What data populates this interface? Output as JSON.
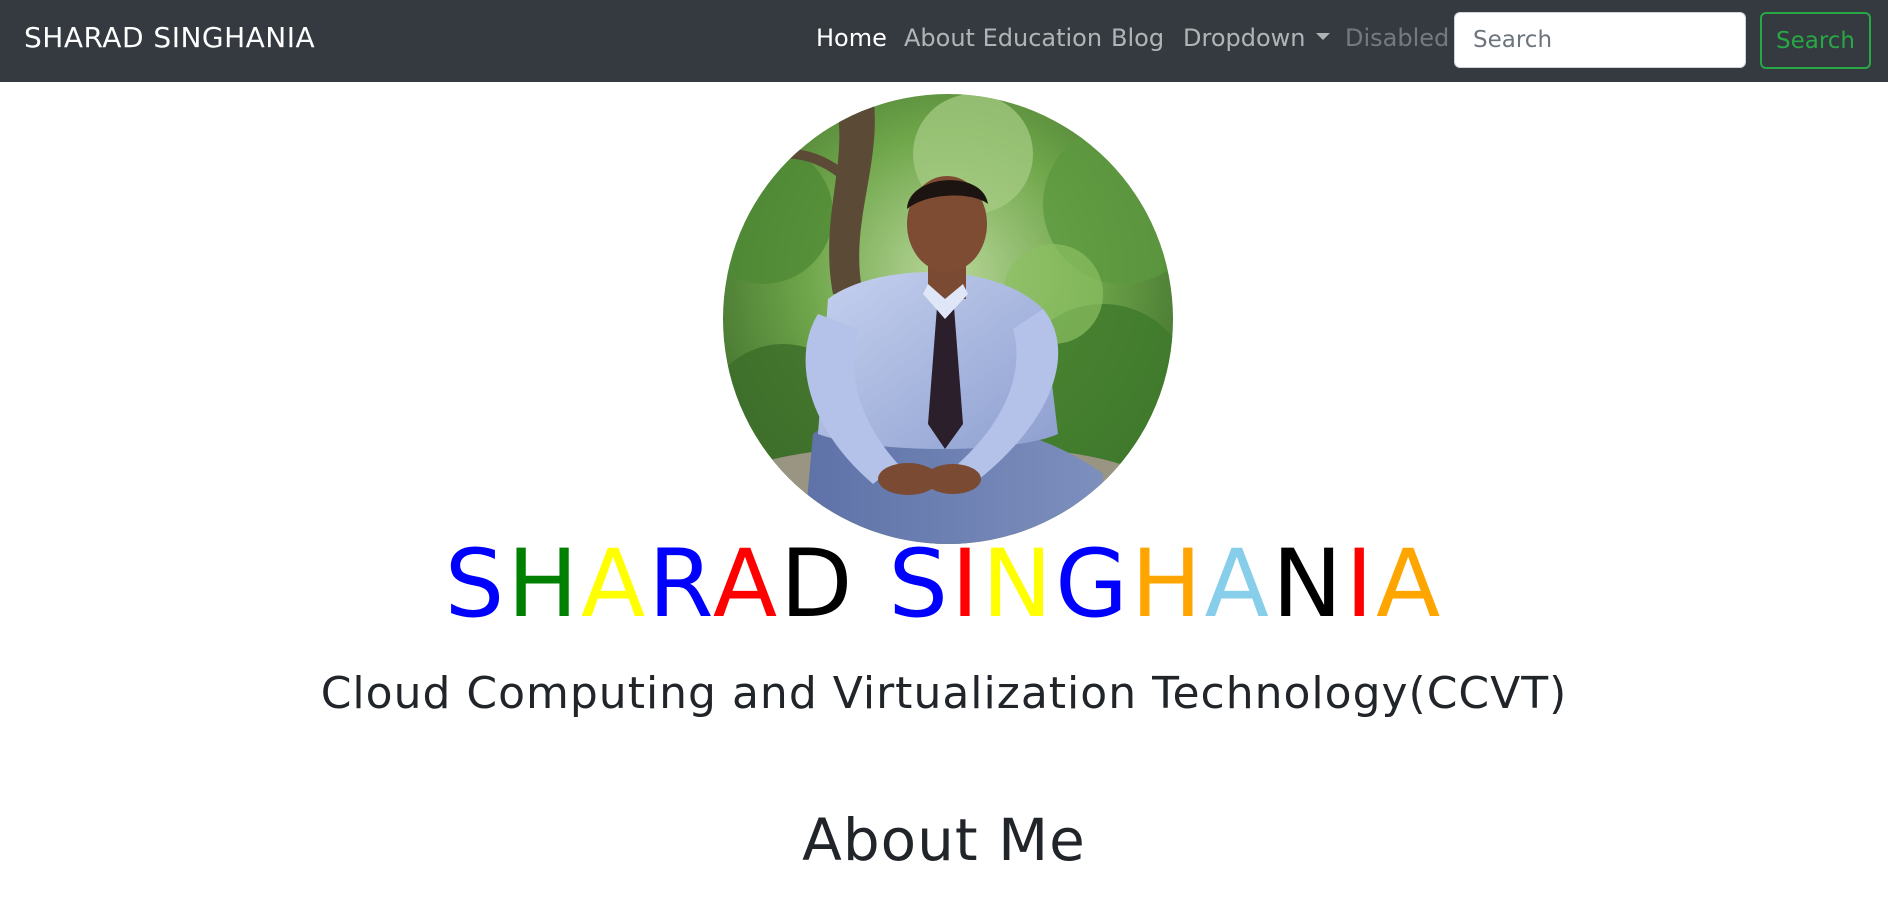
{
  "navbar": {
    "brand": "SHARAD SINGHANIA",
    "links": [
      {
        "label": "Home",
        "state": "active"
      },
      {
        "label": "About Education",
        "state": "normal"
      },
      {
        "label": "Blog",
        "state": "normal"
      },
      {
        "label": "Dropdown",
        "state": "normal",
        "has_caret": true
      },
      {
        "label": "Disabled",
        "state": "disabled"
      }
    ],
    "search": {
      "placeholder": "Search",
      "button_label": "Search"
    },
    "colors": {
      "background": "#343a40",
      "search_button": "#28a745"
    }
  },
  "hero": {
    "name_letters": [
      {
        "char": "S",
        "color": "#0000ff"
      },
      {
        "char": "H",
        "color": "#008000"
      },
      {
        "char": "A",
        "color": "#ffff00"
      },
      {
        "char": "R",
        "color": "#0000ff"
      },
      {
        "char": "A",
        "color": "#ff0000"
      },
      {
        "char": "D",
        "color": "#000000"
      },
      {
        "char": " ",
        "color": "#000000"
      },
      {
        "char": "S",
        "color": "#0000ff"
      },
      {
        "char": "I",
        "color": "#ff0000"
      },
      {
        "char": "N",
        "color": "#ffff00"
      },
      {
        "char": "G",
        "color": "#0000ff"
      },
      {
        "char": "H",
        "color": "#ffa500"
      },
      {
        "char": "A",
        "color": "#87ceeb"
      },
      {
        "char": "N",
        "color": "#000000"
      },
      {
        "char": "I",
        "color": "#ff0000"
      },
      {
        "char": "A",
        "color": "#ffa500"
      }
    ],
    "subtitle": "Cloud Computing and Virtualization Technology(CCVT)"
  },
  "about": {
    "heading": "About Me"
  }
}
